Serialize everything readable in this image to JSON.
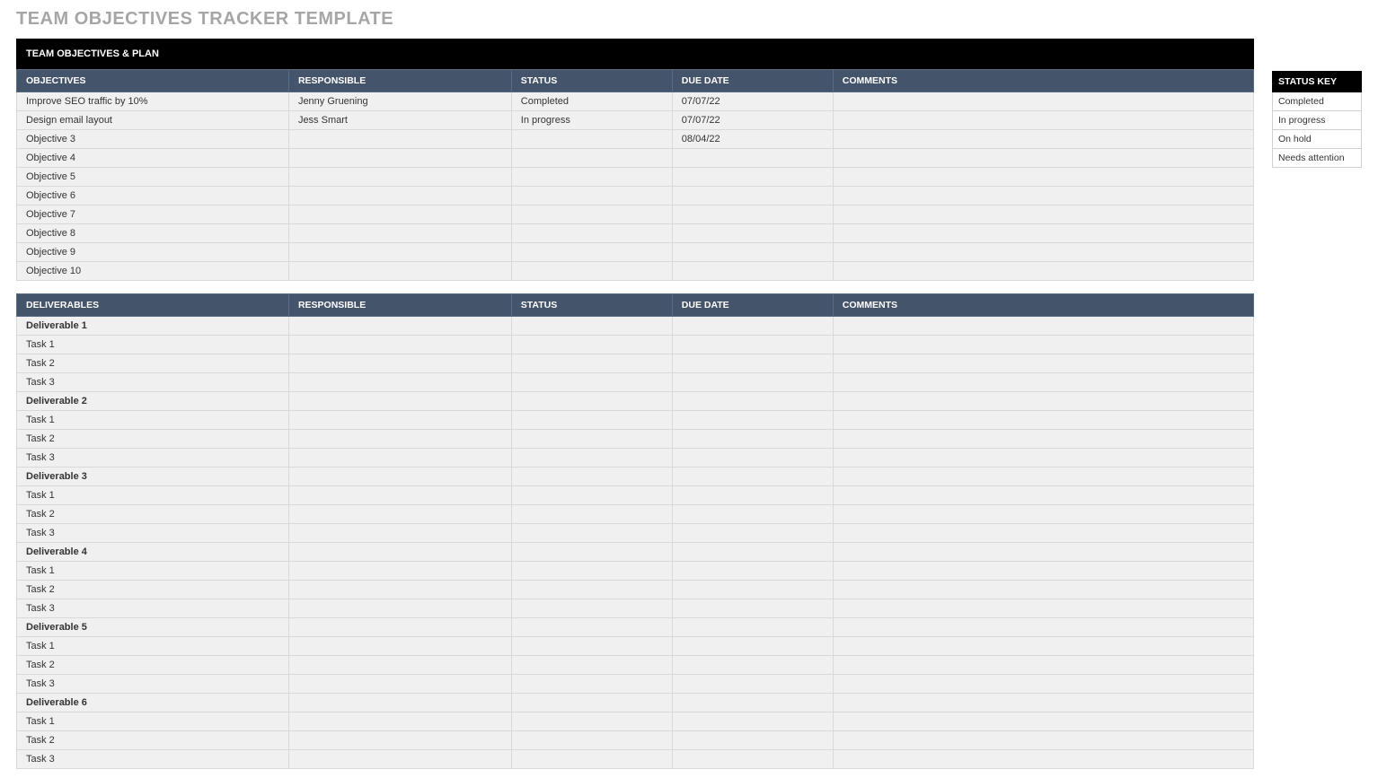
{
  "title": "TEAM OBJECTIVES TRACKER TEMPLATE",
  "section_header": "TEAM OBJECTIVES & PLAN",
  "columns": {
    "objectives": "OBJECTIVES",
    "responsible": "RESPONSIBLE",
    "status": "STATUS",
    "due_date": "DUE DATE",
    "comments": "COMMENTS",
    "deliverables": "DELIVERABLES"
  },
  "objectives": [
    {
      "name": "Improve SEO traffic by 10%",
      "responsible": "Jenny Gruening",
      "status": "Completed",
      "due": "07/07/22",
      "comments": ""
    },
    {
      "name": "Design email layout",
      "responsible": "Jess Smart",
      "status": "In progress",
      "due": "07/07/22",
      "comments": ""
    },
    {
      "name": "Objective 3",
      "responsible": "",
      "status": "",
      "due": "08/04/22",
      "comments": ""
    },
    {
      "name": "Objective 4",
      "responsible": "",
      "status": "",
      "due": "",
      "comments": ""
    },
    {
      "name": "Objective 5",
      "responsible": "",
      "status": "",
      "due": "",
      "comments": ""
    },
    {
      "name": "Objective 6",
      "responsible": "",
      "status": "",
      "due": "",
      "comments": ""
    },
    {
      "name": "Objective 7",
      "responsible": "",
      "status": "",
      "due": "",
      "comments": ""
    },
    {
      "name": "Objective 8",
      "responsible": "",
      "status": "",
      "due": "",
      "comments": ""
    },
    {
      "name": "Objective 9",
      "responsible": "",
      "status": "",
      "due": "",
      "comments": ""
    },
    {
      "name": "Objective 10",
      "responsible": "",
      "status": "",
      "due": "",
      "comments": ""
    }
  ],
  "deliverables": [
    {
      "name": "Deliverable 1",
      "bold": true
    },
    {
      "name": "Task 1"
    },
    {
      "name": "Task 2"
    },
    {
      "name": "Task 3"
    },
    {
      "name": "Deliverable 2",
      "bold": true
    },
    {
      "name": "Task 1"
    },
    {
      "name": "Task 2"
    },
    {
      "name": "Task 3"
    },
    {
      "name": "Deliverable 3",
      "bold": true
    },
    {
      "name": "Task 1"
    },
    {
      "name": "Task 2"
    },
    {
      "name": "Task 3"
    },
    {
      "name": "Deliverable 4",
      "bold": true
    },
    {
      "name": "Task 1"
    },
    {
      "name": "Task 2"
    },
    {
      "name": "Task 3"
    },
    {
      "name": "Deliverable 5",
      "bold": true
    },
    {
      "name": "Task 1"
    },
    {
      "name": "Task 2"
    },
    {
      "name": "Task 3"
    },
    {
      "name": "Deliverable 6",
      "bold": true
    },
    {
      "name": "Task 1"
    },
    {
      "name": "Task 2"
    },
    {
      "name": "Task 3"
    }
  ],
  "status_key": {
    "header": "STATUS KEY",
    "items": [
      "Completed",
      "In progress",
      "On hold",
      "Needs attention"
    ]
  }
}
